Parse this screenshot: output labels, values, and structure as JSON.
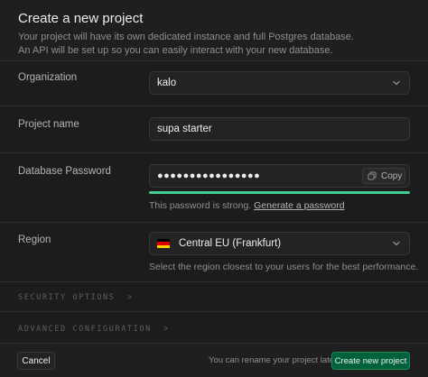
{
  "header": {
    "title": "Create a new project",
    "description_line1": "Your project will have its own dedicated instance and full Postgres database.",
    "description_line2": "An API will be set up so you can easily interact with your new database."
  },
  "organization": {
    "label": "Organization",
    "value": "kalo"
  },
  "project_name": {
    "label": "Project name",
    "value": "supa starter"
  },
  "password": {
    "label": "Database Password",
    "value": "●●●●●●●●●●●●●●●●",
    "copy_label": "Copy",
    "strength": 1.0,
    "strength_color": "#3ecf8e",
    "strength_text": "This password is strong.",
    "generate_link": "Generate a password"
  },
  "region": {
    "label": "Region",
    "value": "Central EU (Frankfurt)",
    "hint": "Select the region closest to your users for the best performance.",
    "flag_colors": [
      "#000000",
      "#dd0000",
      "#ffce00"
    ]
  },
  "sections": {
    "security": "SECURITY OPTIONS",
    "advanced": "ADVANCED CONFIGURATION"
  },
  "footer": {
    "cancel_label": "Cancel",
    "note": "You can rename your project later",
    "create_label": "Create new project"
  },
  "colors": {
    "accent": "#3ecf8e",
    "primary_button": "#00613d"
  }
}
